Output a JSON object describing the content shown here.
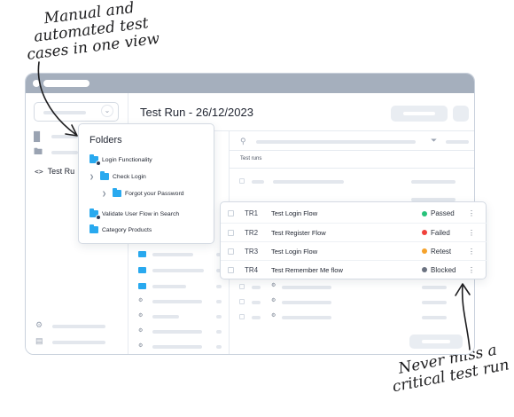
{
  "annotations": {
    "top_lines": [
      "Manual and",
      "automated test",
      "cases in one view"
    ],
    "bottom_lines": [
      "Never miss a",
      "critical test run"
    ]
  },
  "main": {
    "page_title": "Test Run - 26/12/2023",
    "table_header": "Test runs"
  },
  "sidebar": {
    "active_item": "Test Ru"
  },
  "folders": {
    "title": "Folders",
    "items": [
      {
        "label": "Login Functionality",
        "level": 0,
        "icon": "folder-settings-icon"
      },
      {
        "label": "Check Login",
        "level": 1,
        "icon": "folder-icon",
        "expand": "chevron-right-icon"
      },
      {
        "label": "Forgot your Password",
        "level": 2,
        "icon": "folder-icon",
        "expand": "chevron-right-icon"
      },
      {
        "label": "Validate User Flow in Search",
        "level": 0,
        "icon": "folder-settings-icon"
      },
      {
        "label": "Category Products",
        "level": 0,
        "icon": "folder-icon"
      }
    ]
  },
  "runs": [
    {
      "id": "TR1",
      "title": "Test Login Flow",
      "status": "Passed",
      "color": "#27c27a"
    },
    {
      "id": "TR2",
      "title": "Test Register Flow",
      "status": "Failed",
      "color": "#f0413b"
    },
    {
      "id": "TR3",
      "title": "Test Login Flow",
      "status": "Retest",
      "color": "#f5a22c"
    },
    {
      "id": "TR4",
      "title": "Test Remember Me flow",
      "status": "Blocked",
      "color": "#6b7280"
    }
  ],
  "colors": {
    "accent": "#29a9ef",
    "titlebar": "#a5afbd",
    "skeleton": "#e3e7ed"
  }
}
